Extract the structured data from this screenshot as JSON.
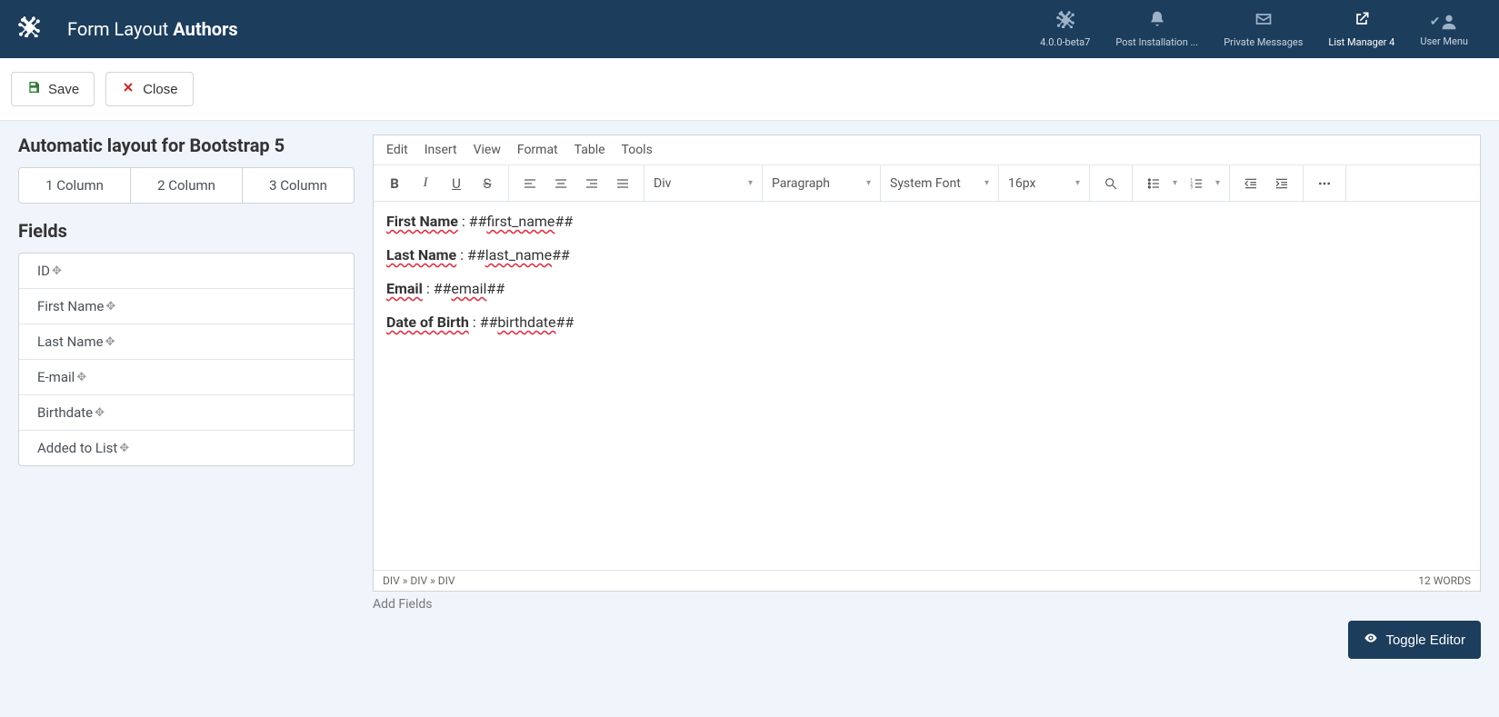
{
  "header": {
    "title_prefix": "Form Layout ",
    "title_strong": "Authors",
    "items": [
      {
        "label": "4.0.0-beta7",
        "icon": "joomla"
      },
      {
        "label": "Post Installation ...",
        "icon": "bell"
      },
      {
        "label": "Private Messages",
        "icon": "envelope"
      },
      {
        "label": "List Manager 4",
        "icon": "external",
        "active": true
      },
      {
        "label": "User Menu",
        "icon": "user-check"
      }
    ]
  },
  "toolbar": {
    "save_label": "Save",
    "close_label": "Close"
  },
  "sidebar": {
    "layout_title": "Automatic layout for Bootstrap 5",
    "columns": [
      "1 Column",
      "2 Column",
      "3 Column"
    ],
    "fields_title": "Fields",
    "fields": [
      "ID",
      "First Name",
      "Last Name",
      "E-mail",
      "Birthdate",
      "Added to List"
    ]
  },
  "editor": {
    "menus": [
      "Edit",
      "Insert",
      "View",
      "Format",
      "Table",
      "Tools"
    ],
    "block_select": "Div",
    "para_select": "Paragraph",
    "font_select": "System Font",
    "size_select": "16px",
    "content": [
      {
        "label": "First Name",
        "sep": " : ",
        "ph_prefix": "##",
        "ph": "first_name",
        "ph_suffix": "##"
      },
      {
        "label": "Last Name",
        "sep": " : ",
        "ph_prefix": "##",
        "ph": "last_name",
        "ph_suffix": "##"
      },
      {
        "label": "Email",
        "sep": " : ",
        "ph_prefix": "##",
        "ph": "email",
        "ph_suffix": "##"
      },
      {
        "label": "Date of Birth",
        "sep": " : ",
        "ph_prefix": "##",
        "ph": "birthdate",
        "ph_suffix": "##"
      }
    ],
    "path": "DIV » DIV » DIV",
    "wordcount": "12 WORDS",
    "add_fields": "Add Fields",
    "toggle_label": "Toggle Editor"
  }
}
